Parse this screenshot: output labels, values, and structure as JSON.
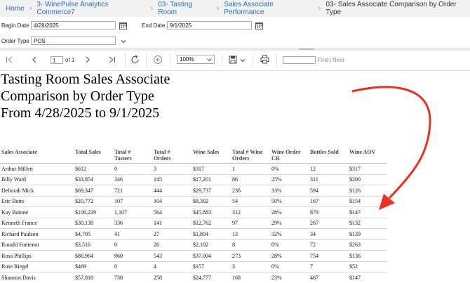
{
  "breadcrumb": {
    "items": [
      "Home",
      "3- WinePulse Analytics Commerce7",
      "03- Tasting Room",
      "Sales Associate Performance"
    ],
    "current": "03- Sales Associate Comparison by Order Type"
  },
  "params": {
    "begin_date_label": "Begin Date",
    "begin_date_value": "4/28/2025",
    "end_date_label": "End Date",
    "end_date_value": "9/1/2025",
    "order_type_label": "Order Type",
    "order_type_value": "POS"
  },
  "toolbar": {
    "page_value": "1",
    "page_of": "of 1",
    "zoom": "100%",
    "find_label": "Find",
    "find_sep": "|",
    "next_label": "Next",
    "find_placeholder": ""
  },
  "report": {
    "title_lines": [
      "Tasting Room Sales Associate",
      "Comparison by Order Type",
      "From 4/28/2025 to 9/1/2025"
    ],
    "columns": [
      [
        "Sales Associate"
      ],
      [
        "Total Sales"
      ],
      [
        "Total #",
        "Tasters"
      ],
      [
        "Total #",
        "Orders"
      ],
      [
        "Wine Sales"
      ],
      [
        "Total # Wine",
        "Orders"
      ],
      [
        "Wine Order",
        "CR"
      ],
      [
        "Bottles Sold"
      ],
      [
        "Wine AOV"
      ]
    ],
    "rows": [
      [
        "Arthur Millett",
        "$612",
        "0",
        "3",
        "$317",
        "1",
        "0%",
        "12",
        "$317"
      ],
      [
        "Billy Ward",
        "$33,854",
        "346",
        "145",
        "$17,201",
        "86",
        "25%",
        "311",
        "$200"
      ],
      [
        "Deborah Mick",
        "$69,347",
        "721",
        "444",
        "$29,737",
        "236",
        "33%",
        "594",
        "$126"
      ],
      [
        "Eric Botts",
        "$20,772",
        "107",
        "104",
        "$8,302",
        "54",
        "50%",
        "167",
        "$154"
      ],
      [
        "Kay Barone",
        "$106,229",
        "1,107",
        "564",
        "$45,883",
        "312",
        "28%",
        "878",
        "$147"
      ],
      [
        "Kenneth France",
        "$30,138",
        "336",
        "141",
        "$12,762",
        "97",
        "29%",
        "267",
        "$132"
      ],
      [
        "Richard Paulson",
        "$4,705",
        "41",
        "27",
        "$1,804",
        "13",
        "32%",
        "34",
        "$139"
      ],
      [
        "Ronald Fontenot",
        "$3,516",
        "0",
        "26",
        "$2,102",
        "8",
        "0%",
        "72",
        "$263"
      ],
      [
        "Rosa Phillips",
        "$86,964",
        "960",
        "543",
        "$37,004",
        "273",
        "28%",
        "754",
        "$136"
      ],
      [
        "Rose Riegel",
        "$469",
        "0",
        "4",
        "$157",
        "3",
        "0%",
        "7",
        "$52"
      ],
      [
        "Shannon Davis",
        "$57,818",
        "738",
        "258",
        "$24,777",
        "168",
        "23%",
        "467",
        "$147"
      ]
    ]
  },
  "colors": {
    "link": "#2f6fb6",
    "annotation_arrow": "#e8321f",
    "breadcrumb_bg": "#f2f2f2"
  },
  "icons": [
    "chevron-right-icon",
    "calendar-icon",
    "chevron-down-icon",
    "first-page-icon",
    "previous-page-icon",
    "next-page-icon",
    "last-page-icon",
    "refresh-icon",
    "back-icon",
    "save-icon",
    "print-icon"
  ]
}
